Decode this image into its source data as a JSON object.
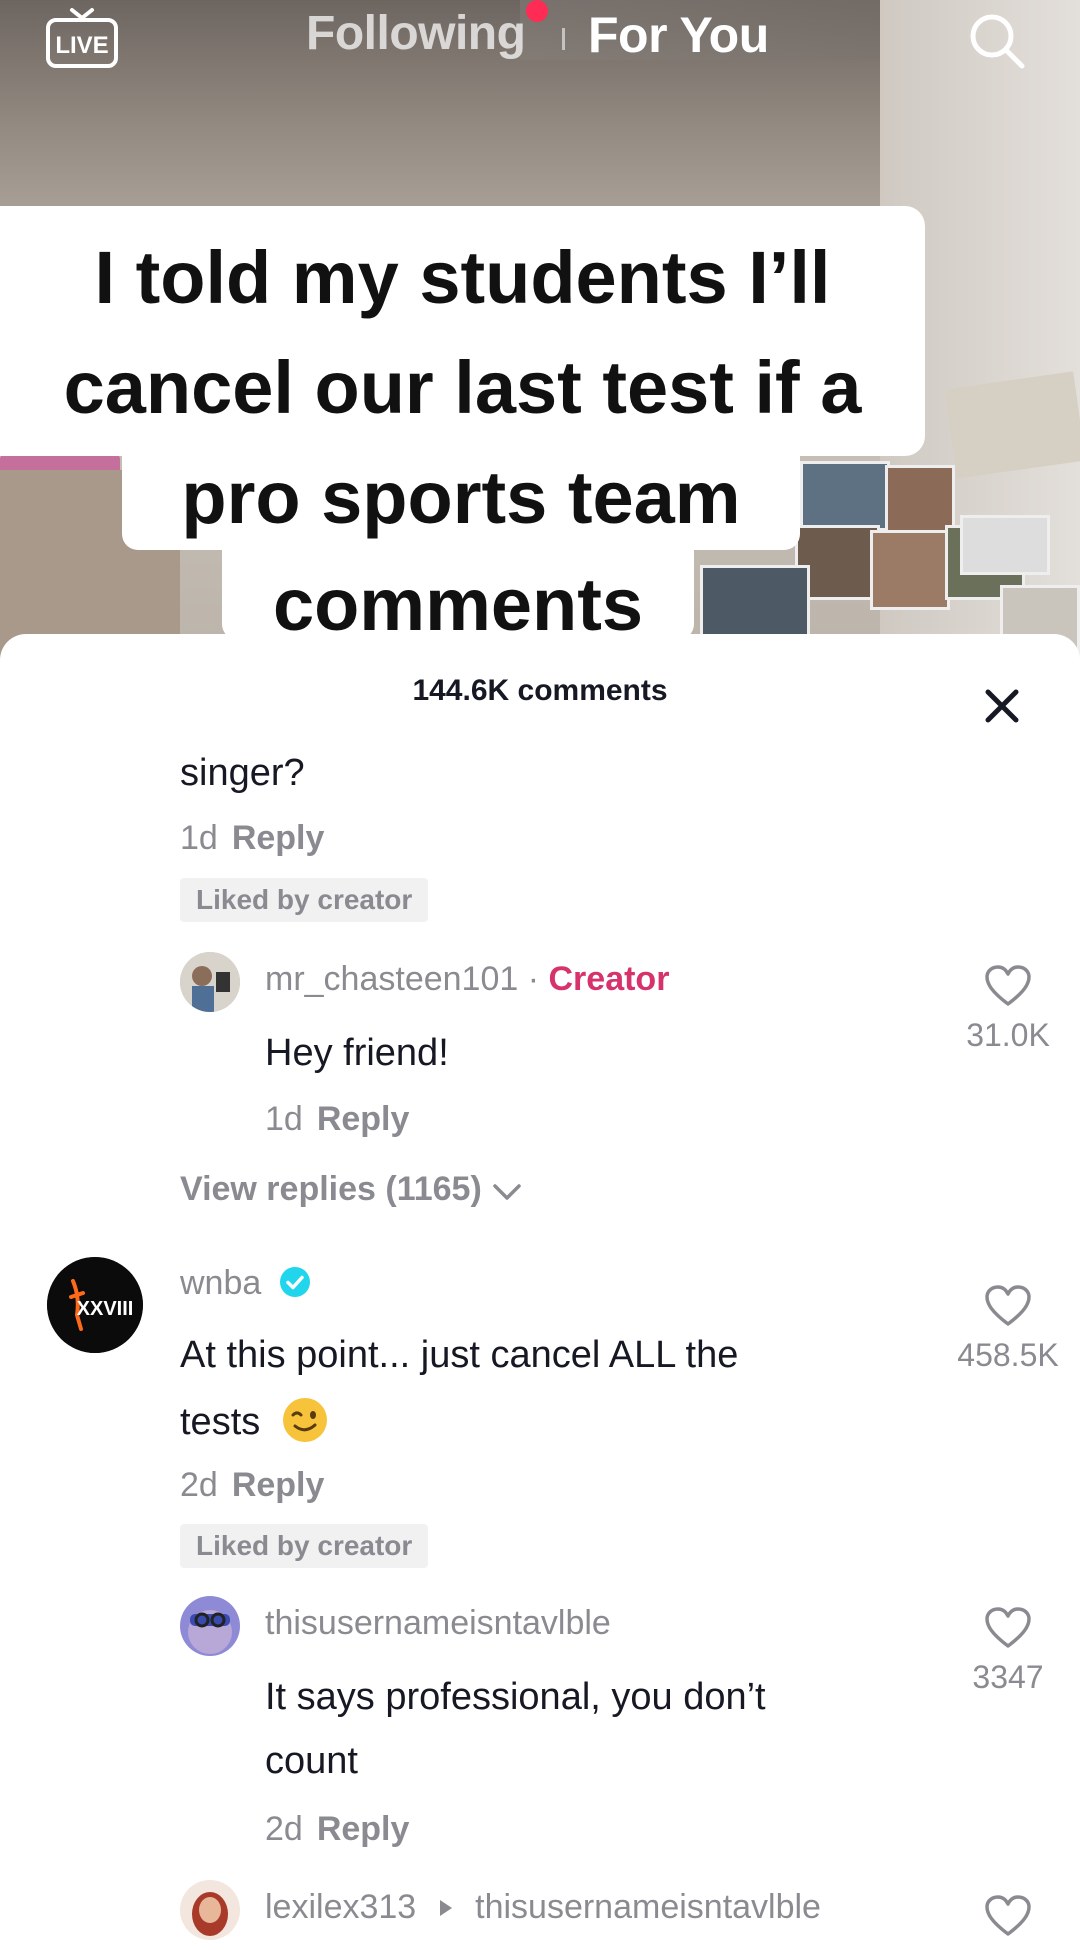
{
  "top_nav": {
    "live_label": "LIVE",
    "following_label": "Following",
    "for_you_label": "For You"
  },
  "caption": {
    "lines": [
      "I told my students I’ll",
      "cancel our last test if a",
      "pro sports team",
      "comments"
    ]
  },
  "comments_sheet": {
    "title": "144.6K comments",
    "comments": [
      {
        "text": "singer?",
        "time": "1d",
        "reply_label": "Reply",
        "liked_badge": "Liked by creator"
      },
      {
        "username": "mr_chasteen101",
        "separator": " · ",
        "creator_label": "Creator",
        "text": "Hey friend!",
        "time": "1d",
        "reply_label": "Reply",
        "likes": "31.0K",
        "view_replies": "View replies (1165)"
      },
      {
        "username": "wnba",
        "verified": true,
        "text_line1": "At this point... just cancel ALL the",
        "text_line2": "tests",
        "time": "2d",
        "reply_label": "Reply",
        "likes": "458.5K",
        "liked_badge": "Liked by creator",
        "avatar_text": "XXVIII"
      },
      {
        "username": "thisusernameisntavlble",
        "text_line1": "It says professional, you don’t",
        "text_line2": "count",
        "time": "2d",
        "reply_label": "Reply",
        "likes": "3347"
      },
      {
        "username": "lexilex313",
        "reply_to": "thisusernameisntavlble"
      }
    ]
  },
  "colors": {
    "accent": "#fe2c55",
    "creator": "#d6326b",
    "verified": "#20d5ec",
    "muted": "#8a8b91",
    "text": "#161823"
  }
}
